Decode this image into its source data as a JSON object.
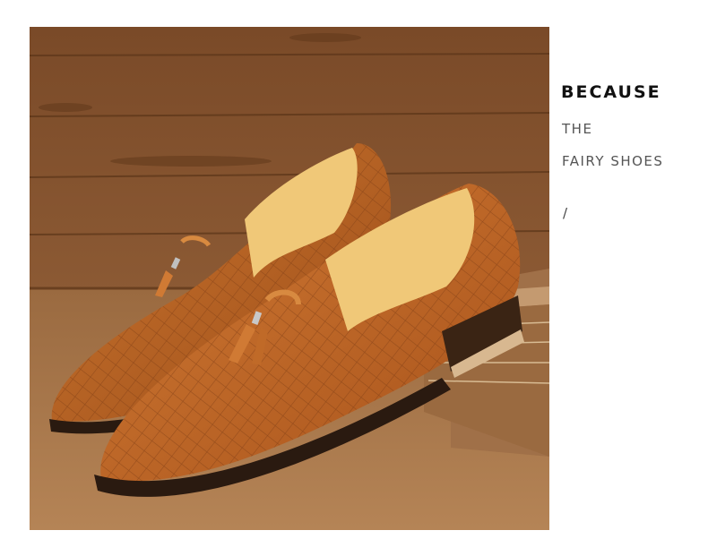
{
  "caption": {
    "title": "BECAUSE",
    "line1": "THE",
    "line2": "FAIRY SHOES",
    "divider": "/"
  },
  "photo": {
    "subject": "loafer-shoes-icon",
    "colors": {
      "wood_dark": "#6e4020",
      "wood_mid": "#8e5a32",
      "wood_light": "#b07a48",
      "leather": "#b8662a",
      "leather_light": "#d88a40",
      "lining": "#f0c878",
      "sole": "#2a1a10",
      "book": "#b88458"
    }
  }
}
